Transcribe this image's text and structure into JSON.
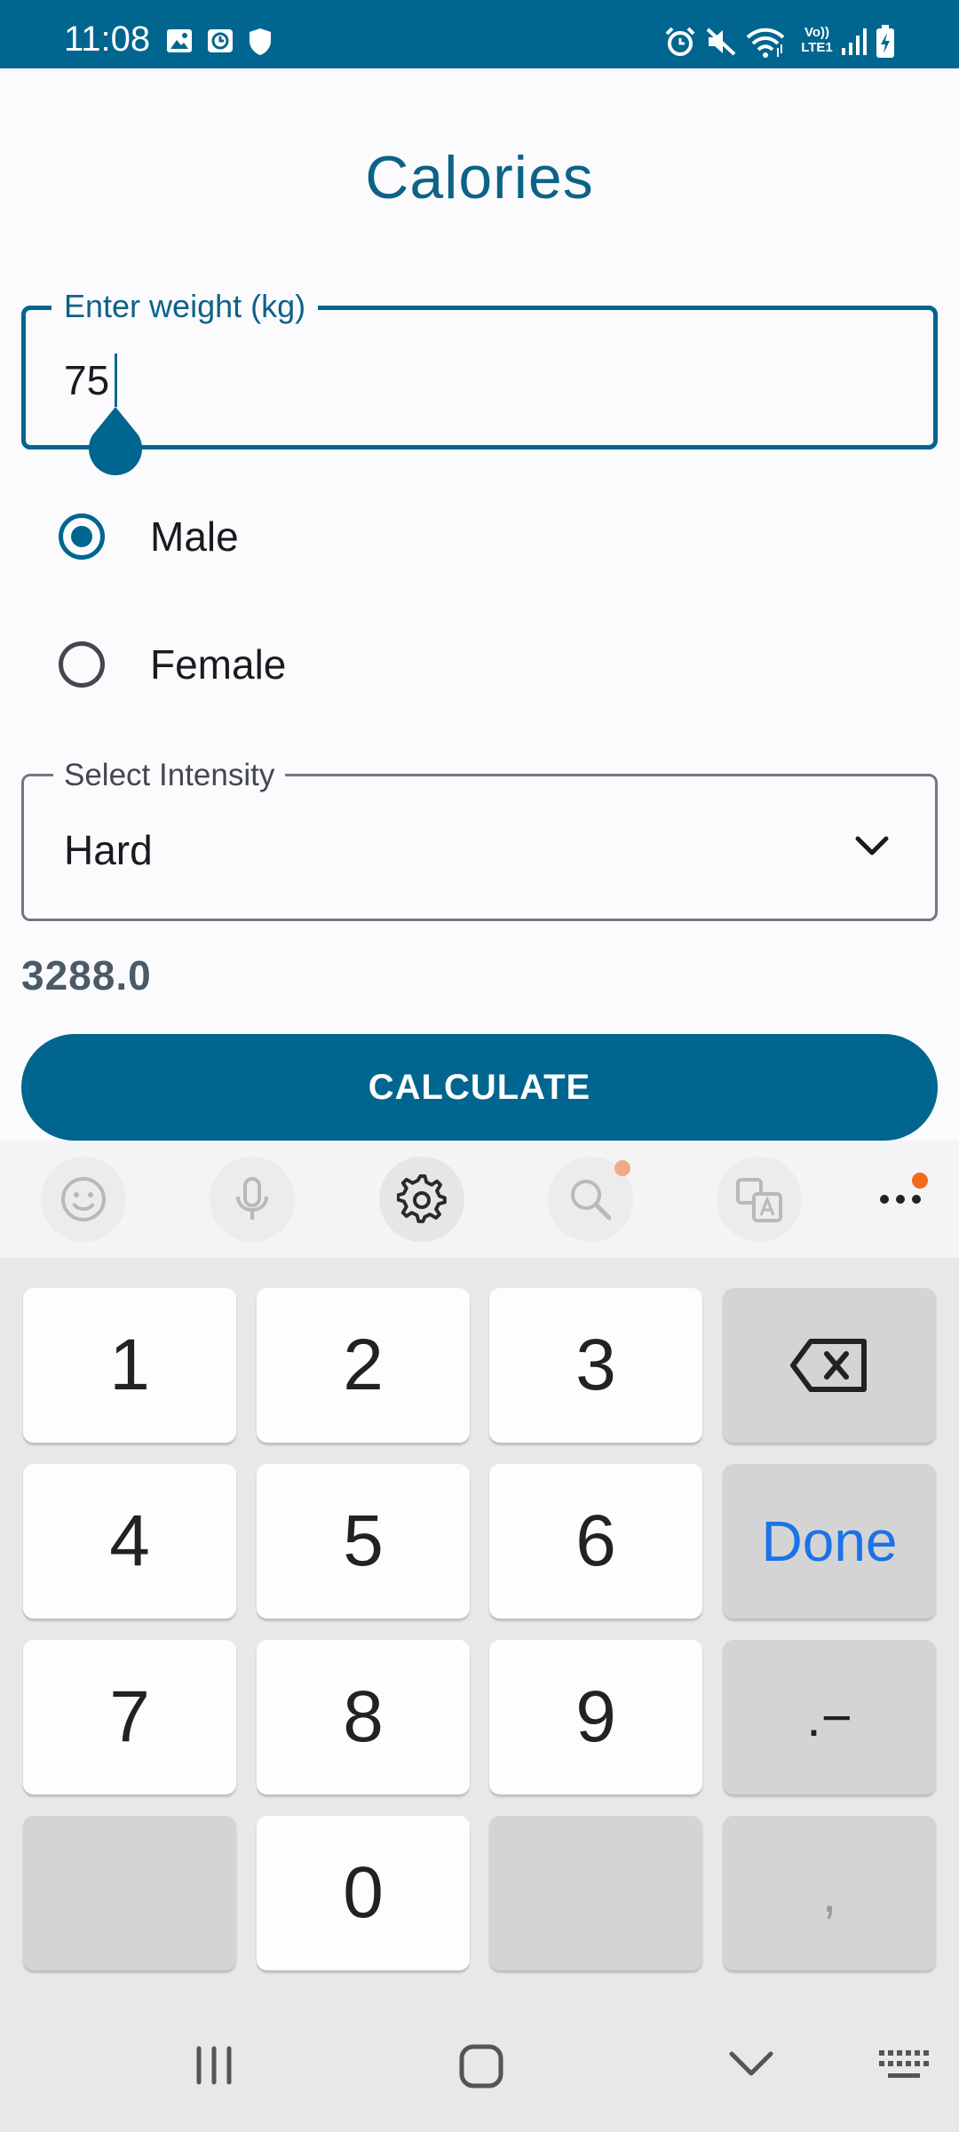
{
  "status_bar": {
    "time": "11:08",
    "left_icons": [
      "image-icon",
      "clock-app-icon",
      "shield-icon"
    ],
    "right_icons": [
      "alarm-icon",
      "mute-icon",
      "wifi-icon",
      "volte-icon",
      "signal-icon",
      "battery-charging-icon"
    ],
    "volte_text_1": "Vo))",
    "volte_text_2": "LTE1"
  },
  "app": {
    "title": "Calories",
    "weight": {
      "label": "Enter weight (kg)",
      "value": "75"
    },
    "gender_options": [
      {
        "label": "Male",
        "checked": true
      },
      {
        "label": "Female",
        "checked": false
      }
    ],
    "intensity": {
      "label": "Select Intensity",
      "value": "Hard"
    },
    "result": "3288.0",
    "calculate_label": "CALCULATE",
    "accent_color": "#00668f"
  },
  "keyboard": {
    "toolbar": [
      "emoji-icon",
      "microphone-icon",
      "settings-icon",
      "search-icon",
      "translate-icon",
      "more-icon"
    ],
    "keys": {
      "k1": "1",
      "k2": "2",
      "k3": "3",
      "k4": "4",
      "k5": "5",
      "k6": "6",
      "k7": "7",
      "k8": "8",
      "k9": "9",
      "k0": "0",
      "done": "Done",
      "dot_minus": ".−",
      "comma": ","
    },
    "done_color": "#1a73e8",
    "notification_color": "#f26b1d"
  },
  "nav_bar": [
    "recents-icon",
    "home-icon",
    "back-chevron-icon",
    "keyboard-icon"
  ]
}
